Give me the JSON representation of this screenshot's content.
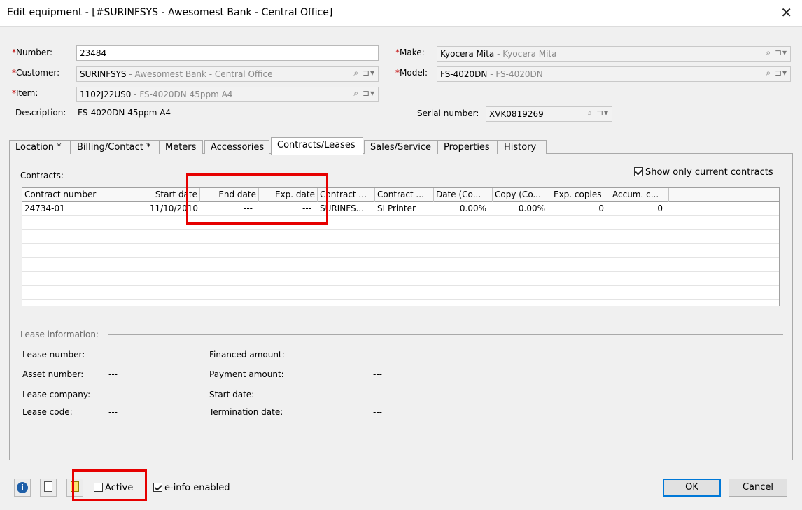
{
  "window": {
    "title": "Edit equipment - [#SURINFSYS - Awesomest Bank - Central Office]"
  },
  "form": {
    "number": {
      "label": "Number:",
      "value": "23484"
    },
    "customer": {
      "label": "Customer:",
      "code": "SURINFSYS",
      "desc": " - Awesomest Bank - Central Office"
    },
    "item": {
      "label": "Item:",
      "code": "1102J22US0",
      "desc": " - FS-4020DN 45ppm A4"
    },
    "description": {
      "label": "Description:",
      "value": "FS-4020DN 45ppm A4"
    },
    "make": {
      "label": "Make:",
      "code": "Kyocera Mita",
      "desc": " - Kyocera Mita"
    },
    "model": {
      "label": "Model:",
      "code": "FS-4020DN",
      "desc": " - FS-4020DN"
    },
    "serial": {
      "label": "Serial number:",
      "value": "XVK0819269"
    },
    "required_mark": "*"
  },
  "tabs": [
    "Location *",
    "Billing/Contact *",
    "Meters",
    "Accessories",
    "Contracts/Leases",
    "Sales/Service",
    "Properties",
    "History"
  ],
  "contracts": {
    "label": "Contracts:",
    "show_current_label": "Show only current contracts",
    "columns": [
      "Contract number",
      "Start date",
      "End date",
      "Exp. date",
      "Contract ...",
      "Contract ...",
      "Date (Co...",
      "Copy (Co...",
      "Exp. copies",
      "Accum. c..."
    ],
    "rows": [
      [
        "24734-01",
        "11/10/2010",
        "---",
        "---",
        "SURINFS...",
        "SI Printer",
        "0.00%",
        "0.00%",
        "0",
        "0"
      ]
    ]
  },
  "lease": {
    "section_label": "Lease information:",
    "lease_number": {
      "label": "Lease number:",
      "value": "---"
    },
    "asset_number": {
      "label": "Asset number:",
      "value": "---"
    },
    "lease_company": {
      "label": "Lease company:",
      "value": "---"
    },
    "lease_code": {
      "label": "Lease code:",
      "value": "---"
    },
    "financed_amount": {
      "label": "Financed amount:",
      "value": "---"
    },
    "payment_amount": {
      "label": "Payment amount:",
      "value": "---"
    },
    "start_date": {
      "label": "Start date:",
      "value": "---"
    },
    "termination_date": {
      "label": "Termination date:",
      "value": "---"
    }
  },
  "footer": {
    "active_label": "Active",
    "einfo_label": "e-info enabled",
    "ok_label": "OK",
    "cancel_label": "Cancel",
    "info_icon_glyph": "i"
  },
  "icons": {
    "close": "close-icon",
    "search": "search-icon",
    "dropdown": "dropdown-icon",
    "info": "info-icon",
    "note": "note-icon"
  },
  "colors": {
    "required": "#c00000",
    "highlight": "#e60000",
    "accent": "#0078d7"
  }
}
